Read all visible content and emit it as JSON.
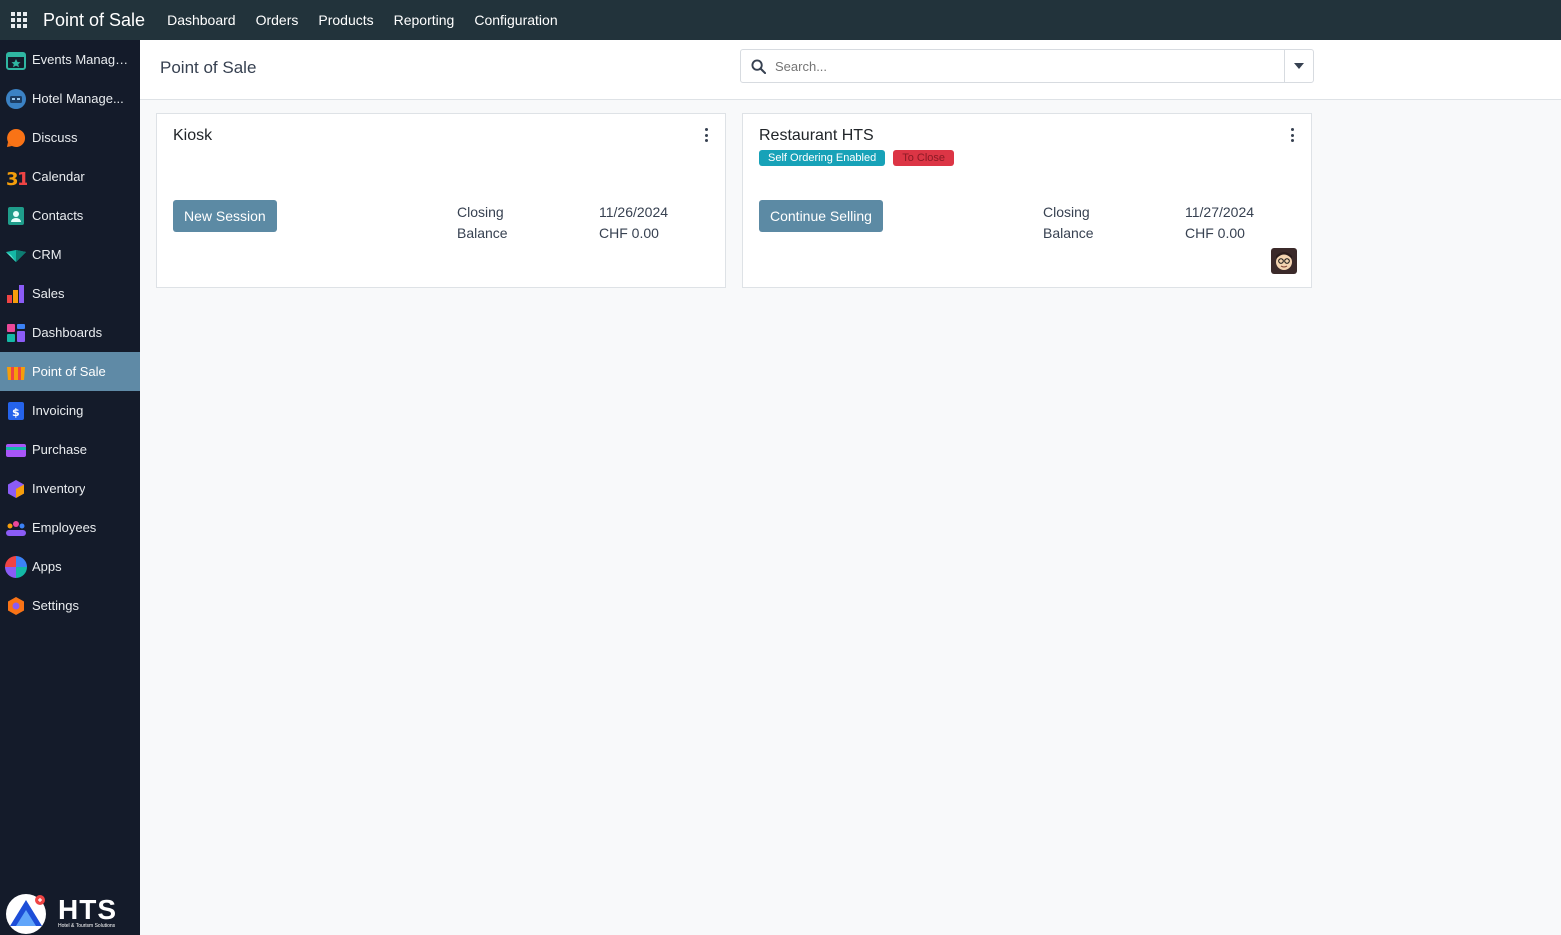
{
  "topbar": {
    "app_title": "Point of Sale",
    "menu": [
      "Dashboard",
      "Orders",
      "Products",
      "Reporting",
      "Configuration"
    ]
  },
  "sidebar": {
    "items": [
      {
        "label": "Events Manage...",
        "icon": "events-icon"
      },
      {
        "label": "Hotel Manage...",
        "icon": "hotel-icon"
      },
      {
        "label": "Discuss",
        "icon": "discuss-icon"
      },
      {
        "label": "Calendar",
        "icon": "calendar-icon"
      },
      {
        "label": "Contacts",
        "icon": "contacts-icon"
      },
      {
        "label": "CRM",
        "icon": "crm-icon"
      },
      {
        "label": "Sales",
        "icon": "sales-icon"
      },
      {
        "label": "Dashboards",
        "icon": "dashboards-icon"
      },
      {
        "label": "Point of Sale",
        "icon": "pos-icon",
        "active": true
      },
      {
        "label": "Invoicing",
        "icon": "invoicing-icon"
      },
      {
        "label": "Purchase",
        "icon": "purchase-icon"
      },
      {
        "label": "Inventory",
        "icon": "inventory-icon"
      },
      {
        "label": "Employees",
        "icon": "employees-icon"
      },
      {
        "label": "Apps",
        "icon": "apps-icon"
      },
      {
        "label": "Settings",
        "icon": "settings-icon"
      }
    ],
    "brand_name": "HTS",
    "brand_tagline": "Hotel & Tourism Solutions"
  },
  "control_panel": {
    "breadcrumb": "Point of Sale",
    "search_placeholder": "Search..."
  },
  "cards": [
    {
      "title": "Kiosk",
      "button": "New Session",
      "closing_label": "Closing",
      "closing_value": "11/26/2024",
      "balance_label": "Balance",
      "balance_value": "CHF 0.00"
    },
    {
      "title": "Restaurant HTS",
      "badges": [
        "Self Ordering Enabled",
        "To Close"
      ],
      "button": "Continue Selling",
      "closing_label": "Closing",
      "closing_value": "11/27/2024",
      "balance_label": "Balance",
      "balance_value": "CHF 0.00"
    }
  ],
  "colors": {
    "topbar": "#22333b",
    "sidebar": "#141b2a",
    "active_item": "#5f8aa6",
    "primary_button": "#5c8aa4",
    "badge_teal": "#17a2b8",
    "badge_red": "#dc3545"
  }
}
